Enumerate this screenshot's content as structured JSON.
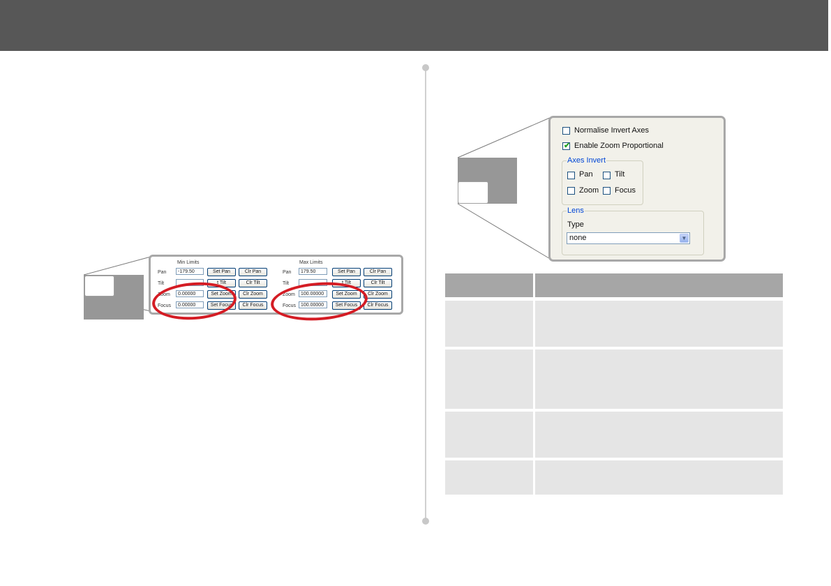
{
  "limits_panel": {
    "min_title": "Min Limits",
    "max_title": "Max Limits",
    "rows": [
      {
        "label": "Pan",
        "min_value": "-179.50",
        "set_min": "Set Pan",
        "clr_min": "Clr Pan",
        "max_value": "179.50",
        "set_max": "Set Pan",
        "clr_max": "Clr Pan"
      },
      {
        "label": "Tilt",
        "min_value": "",
        "set_min": "t Tilt",
        "clr_min": "Clr Tilt",
        "max_value": "",
        "set_max": "t Tilt",
        "clr_max": "Clr Tilt"
      },
      {
        "label": "Zoom",
        "min_value": "0.00000",
        "set_min": "Set Zoom",
        "clr_min": "Clr Zoom",
        "max_value": "100.00000",
        "set_max": "Set Zoom",
        "clr_max": "Clr Zoom"
      },
      {
        "label": "Focus",
        "min_value": "0.00000",
        "set_min": "Set Focus",
        "clr_min": "Clr Focus",
        "max_value": "100.00000",
        "set_max": "Set Focus",
        "clr_max": "Clr Focus"
      }
    ],
    "highlight_color": "#d41c24"
  },
  "dialog": {
    "normalise_label": "Normalise Invert Axes",
    "normalise_checked": false,
    "zoom_prop_label": "Enable Zoom Proportional",
    "zoom_prop_checked": true,
    "axes_invert_title": "Axes Invert",
    "pan_label": "Pan",
    "tilt_label": "Tilt",
    "zoom_label": "Zoom",
    "focus_label": "Focus",
    "lens_title": "Lens",
    "type_label": "Type",
    "type_value": "none"
  },
  "colors": {
    "header": "#575757",
    "table_header": "#a6a6a6",
    "table_cell": "#e5e5e5"
  }
}
